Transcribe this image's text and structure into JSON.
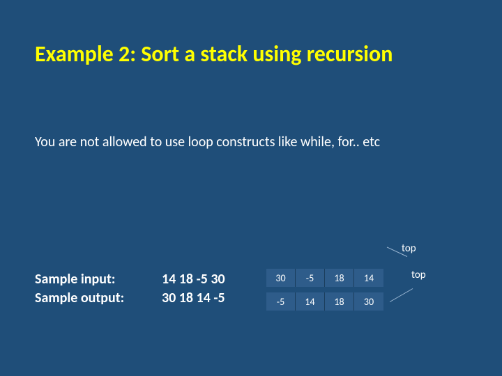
{
  "title": "Example 2: Sort a stack using recursion",
  "subtitle": "You are not allowed to use loop constructs like while, for.. etc",
  "sample": {
    "input_label": "Sample input:",
    "output_label": "Sample output:",
    "input_values": "14 18 -5 30",
    "output_values": "30 18 14 -5"
  },
  "top_label_1": "top",
  "top_label_2": "top",
  "stack_input": {
    "c0": "30",
    "c1": "-5",
    "c2": "18",
    "c3": "14"
  },
  "stack_output": {
    "c0": "-5",
    "c1": "14",
    "c2": "18",
    "c3": "30"
  }
}
